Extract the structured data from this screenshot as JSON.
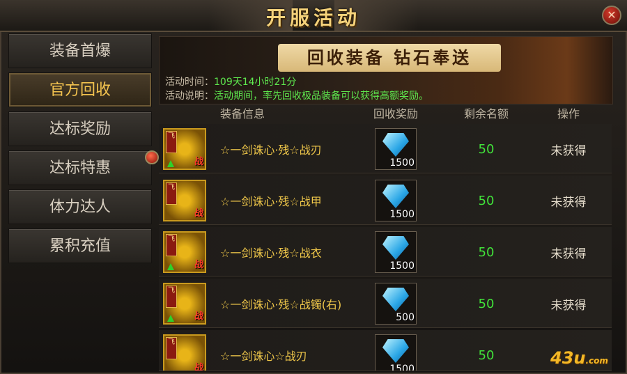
{
  "window": {
    "title": "开服活动",
    "close_symbol": "✕"
  },
  "sidebar": {
    "items": [
      {
        "label": "装备首爆"
      },
      {
        "label": "官方回收"
      },
      {
        "label": "达标奖励"
      },
      {
        "label": "达标特惠"
      },
      {
        "label": "体力达人"
      },
      {
        "label": "累积充值"
      }
    ],
    "active_index": 1
  },
  "banner": {
    "title": "回收装备  钻石奉送",
    "time_label": "活动时间：",
    "time_value": "109天14小时21分",
    "desc_label": "活动说明：",
    "desc_value": "活动期间，率先回收极品装备可以获得高额奖励。"
  },
  "table": {
    "headers": [
      "装备信息",
      "回收奖励",
      "剩余名额",
      "操作"
    ],
    "rows": [
      {
        "name": "☆一剑诛心·残☆战刃",
        "reward": "1500",
        "remaining": "50",
        "status": "未获得",
        "icon_tag": "飞",
        "icon_mark": "战"
      },
      {
        "name": "☆一剑诛心·残☆战甲",
        "reward": "1500",
        "remaining": "50",
        "status": "未获得",
        "icon_tag": "飞",
        "icon_mark": "战"
      },
      {
        "name": "☆一剑诛心·残☆战衣",
        "reward": "1500",
        "remaining": "50",
        "status": "未获得",
        "icon_tag": "飞",
        "icon_mark": "战"
      },
      {
        "name": "☆一剑诛心·残☆战镯(右)",
        "reward": "500",
        "remaining": "50",
        "status": "未获得",
        "icon_tag": "飞",
        "icon_mark": "战"
      },
      {
        "name": "☆一剑诛心☆战刃",
        "reward": "1500",
        "remaining": "50",
        "status": "",
        "icon_tag": "飞",
        "icon_mark": "战"
      }
    ]
  },
  "watermark": {
    "main": "43u",
    "suffix": ".com"
  },
  "colors": {
    "accent_gold": "#f3c34f",
    "remaining_green": "#41e33a",
    "time_green": "#5ee84e"
  }
}
